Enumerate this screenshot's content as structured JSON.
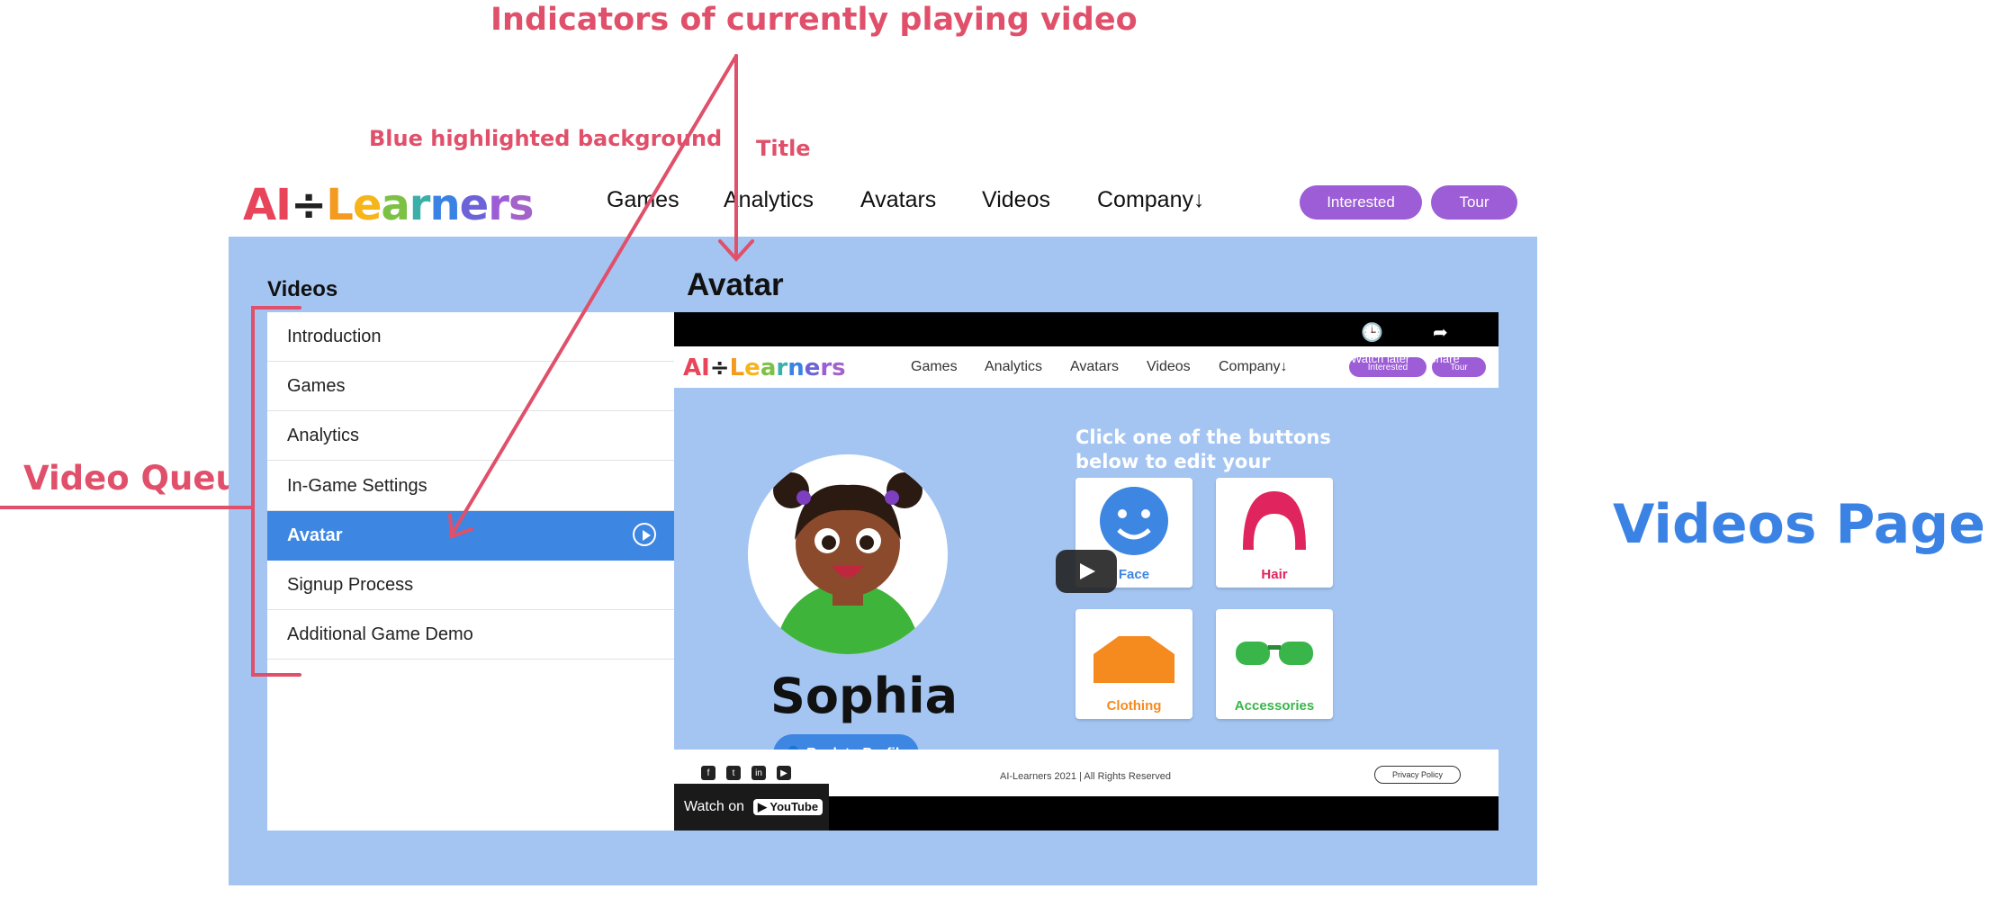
{
  "annotations": {
    "indicators": "Indicators of currently playing video",
    "blue_background": "Blue highlighted background",
    "title": "Title",
    "video_queue": "Video Queue",
    "page_label": "Videos Page"
  },
  "header": {
    "logo": {
      "part1": "AI",
      "divider": "÷",
      "letters": [
        "L",
        "e",
        "a",
        "r",
        "n",
        "e",
        "r",
        "s"
      ]
    },
    "nav": [
      "Games",
      "Analytics",
      "Avatars",
      "Videos",
      "Company↓"
    ],
    "buttons": {
      "interested": "Interested",
      "tour": "Tour"
    }
  },
  "sidebar": {
    "heading": "Videos",
    "items": [
      {
        "label": "Introduction"
      },
      {
        "label": "Games"
      },
      {
        "label": "Analytics"
      },
      {
        "label": "In-Game Settings"
      },
      {
        "label": "Avatar",
        "active": true
      },
      {
        "label": "Signup Process"
      },
      {
        "label": "Additional Game Demo"
      }
    ]
  },
  "main": {
    "title": "Avatar"
  },
  "video": {
    "watch_later": "Watch later",
    "share": "Share",
    "inner_nav": [
      "Games",
      "Analytics",
      "Avatars",
      "Videos",
      "Company↓"
    ],
    "inner_buttons": [
      "Interested",
      "Tour"
    ],
    "instructions": "Click one of the buttons below to edit your avatar!",
    "avatar_name": "Sophia",
    "back_button": "Back to Profile",
    "cards": [
      "Face",
      "Hair",
      "Clothing",
      "Accessories"
    ],
    "copyright": "AI-Learners 2021 | All Rights Reserved",
    "privacy": "Privacy Policy",
    "watch_on": "Watch on",
    "youtube": "YouTube"
  },
  "colors": {
    "panel": "#a4c5f2",
    "active": "#3d86e2",
    "annotation": "#e0506a",
    "purple": "#9c5dd6"
  }
}
